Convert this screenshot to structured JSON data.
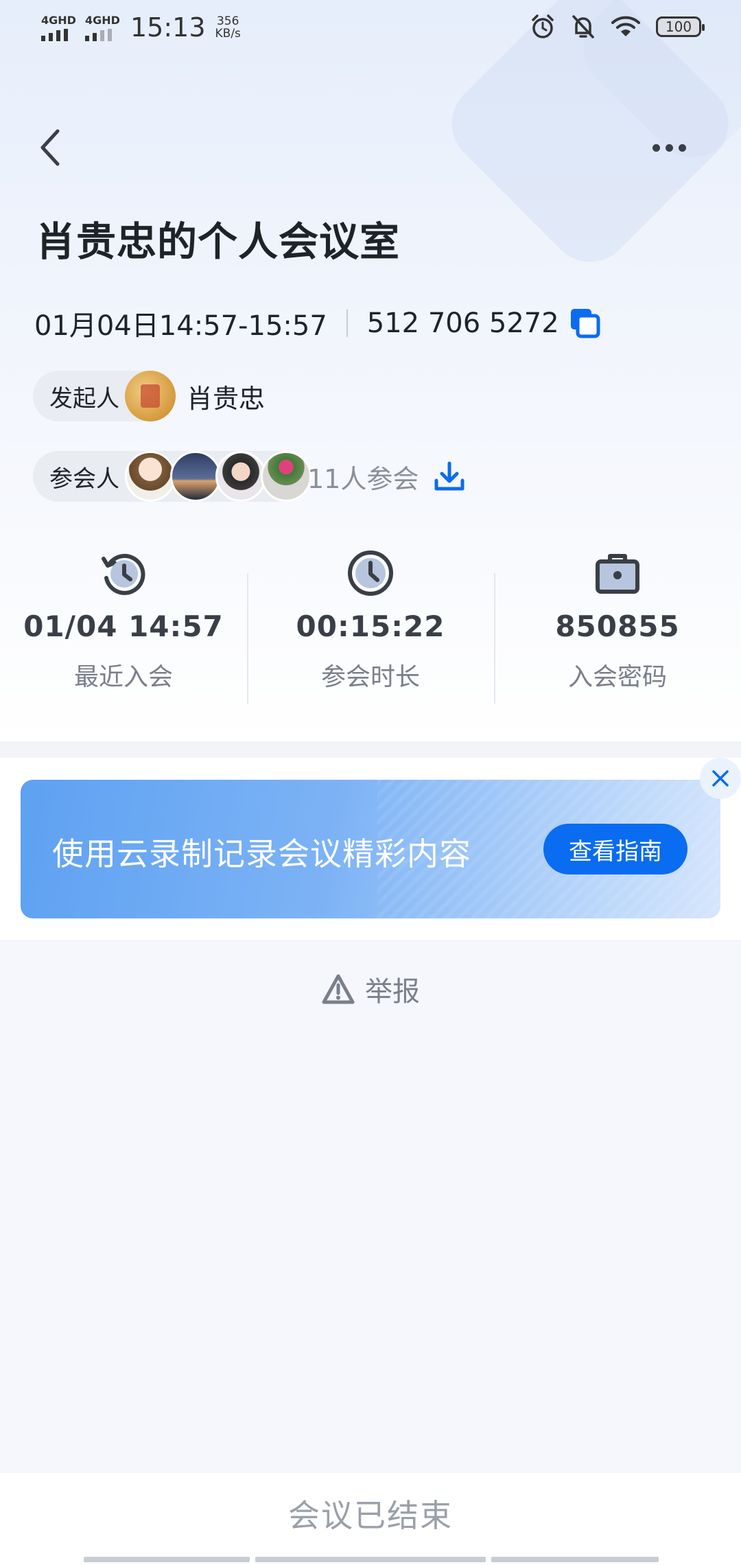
{
  "status_bar": {
    "net1": "4GHD",
    "net2": "4GHD",
    "time": "15:13",
    "speed_value": "356",
    "speed_unit": "KB/s",
    "battery": "100"
  },
  "meeting": {
    "title": "肖贵忠的个人会议室",
    "time_range": "01月04日14:57-15:57",
    "meeting_id": "512 706 5272",
    "host_label": "发起人",
    "host_name": "肖贵忠",
    "participants_label": "参会人",
    "participants_count": "11人参会"
  },
  "stats": [
    {
      "value": "01/04 14:57",
      "label": "最近入会",
      "icon": "history-clock-icon"
    },
    {
      "value": "00:15:22",
      "label": "参会时长",
      "icon": "clock-icon"
    },
    {
      "value": "850855",
      "label": "入会密码",
      "icon": "lock-bag-icon"
    }
  ],
  "banner": {
    "text": "使用云录制记录会议精彩内容",
    "button": "查看指南"
  },
  "report_label": "举报",
  "footer_status": "会议已结束",
  "colors": {
    "accent": "#0a6cf0",
    "title": "#1f2329",
    "muted": "#7a7f89"
  }
}
